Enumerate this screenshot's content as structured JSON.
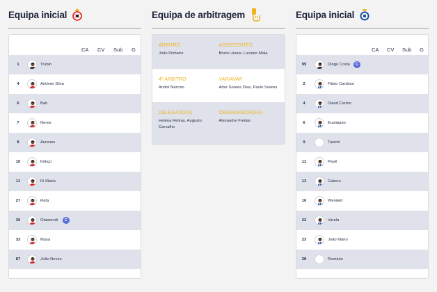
{
  "home": {
    "title": "Equipa inicial",
    "crest_color": "#e0161b",
    "headers": [
      "CA",
      "CV",
      "Sub",
      "G"
    ],
    "players": [
      {
        "num": "1",
        "name": "Trubin",
        "kit": "keeper"
      },
      {
        "num": "4",
        "name": "António Silva",
        "kit": "red"
      },
      {
        "num": "6",
        "name": "Bah",
        "kit": "red"
      },
      {
        "num": "7",
        "name": "Neres",
        "kit": "red"
      },
      {
        "num": "8",
        "name": "Aursnes",
        "kit": "red"
      },
      {
        "num": "10",
        "name": "Kökçü",
        "kit": "red"
      },
      {
        "num": "11",
        "name": "Di María",
        "kit": "red"
      },
      {
        "num": "27",
        "name": "Rafa",
        "kit": "red"
      },
      {
        "num": "30",
        "name": "Otamendi",
        "kit": "red",
        "captain": "C"
      },
      {
        "num": "33",
        "name": "Musa",
        "kit": "red"
      },
      {
        "num": "87",
        "name": "João Neves",
        "kit": "red"
      }
    ]
  },
  "refs": {
    "title": "Equipa de arbitragem",
    "rows": [
      [
        {
          "label": "ÁRBITRO",
          "value": "João Pinheiro"
        },
        {
          "label": "ASSISTENTES",
          "value": "Bruno Jesus, Luciano Maia"
        }
      ],
      [
        {
          "label": "4º ÁRBITRO",
          "value": "André Narciso"
        },
        {
          "label": "VAR/AVAR",
          "value": "Artur Soares Dias, Paulo Soares"
        }
      ],
      [
        {
          "label": "DELEGADO(S)",
          "value": "Helena Relvas, Augusto Carvalho"
        },
        {
          "label": "OBSERVADOR(ES)",
          "value": "Alexandre Freitas"
        }
      ]
    ]
  },
  "away": {
    "title": "Equipa inicial",
    "crest_color": "#1a4fa0",
    "headers": [
      "CA",
      "CV",
      "Sub",
      "G"
    ],
    "players": [
      {
        "num": "99",
        "name": "Diogo Costa",
        "kit": "keeper",
        "captain": "C"
      },
      {
        "num": "2",
        "name": "Fábio Cardoso",
        "kit": "blue"
      },
      {
        "num": "4",
        "name": "David Carmo",
        "kit": "blue"
      },
      {
        "num": "6",
        "name": "Eustáquio",
        "kit": "blue"
      },
      {
        "num": "9",
        "name": "Taremi",
        "kit": "none"
      },
      {
        "num": "11",
        "name": "Pepê",
        "kit": "blue"
      },
      {
        "num": "13",
        "name": "Galeno",
        "kit": "blue"
      },
      {
        "num": "16",
        "name": "Wendell",
        "kit": "blue"
      },
      {
        "num": "22",
        "name": "Varela",
        "kit": "blue"
      },
      {
        "num": "23",
        "name": "João Mário",
        "kit": "blue"
      },
      {
        "num": "28",
        "name": "Romário",
        "kit": "none"
      }
    ]
  }
}
